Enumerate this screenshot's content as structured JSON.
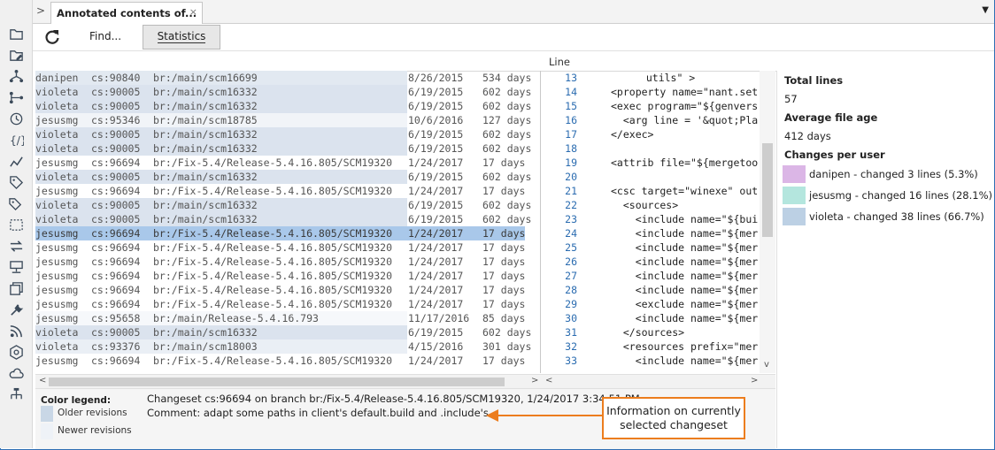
{
  "tab": {
    "prev": ">",
    "title": "Annotated contents of...",
    "close": "×",
    "menu": "▼"
  },
  "toolbar": {
    "find_label": "Find...",
    "statistics_label": "Statistics"
  },
  "grid": {
    "line_header": "Line",
    "rows": [
      {
        "user": "danipen",
        "cs": "cs:90840",
        "branch": "br:/main/scm16699",
        "date": "8/26/2015",
        "age": "534 days",
        "hl": "#e2e9f1"
      },
      {
        "user": "violeta",
        "cs": "cs:90005",
        "branch": "br:/main/scm16332",
        "date": "6/19/2015",
        "age": "602 days",
        "hl": "#dbe3ee"
      },
      {
        "user": "violeta",
        "cs": "cs:90005",
        "branch": "br:/main/scm16332",
        "date": "6/19/2015",
        "age": "602 days",
        "hl": "#dbe3ee"
      },
      {
        "user": "jesusmg",
        "cs": "cs:95346",
        "branch": "br:/main/scm18785",
        "date": "10/6/2016",
        "age": "127 days",
        "hl": "#f1f4f8"
      },
      {
        "user": "violeta",
        "cs": "cs:90005",
        "branch": "br:/main/scm16332",
        "date": "6/19/2015",
        "age": "602 days",
        "hl": "#dbe3ee"
      },
      {
        "user": "violeta",
        "cs": "cs:90005",
        "branch": "br:/main/scm16332",
        "date": "6/19/2015",
        "age": "602 days",
        "hl": "#dbe3ee"
      },
      {
        "user": "jesusmg",
        "cs": "cs:96694",
        "branch": "br:/Fix-5.4/Release-5.4.16.805/SCM19320",
        "date": "1/24/2017",
        "age": "17 days",
        "hl": "#ffffff"
      },
      {
        "user": "violeta",
        "cs": "cs:90005",
        "branch": "br:/main/scm16332",
        "date": "6/19/2015",
        "age": "602 days",
        "hl": "#dbe3ee"
      },
      {
        "user": "jesusmg",
        "cs": "cs:96694",
        "branch": "br:/Fix-5.4/Release-5.4.16.805/SCM19320",
        "date": "1/24/2017",
        "age": "17 days",
        "hl": "#ffffff"
      },
      {
        "user": "violeta",
        "cs": "cs:90005",
        "branch": "br:/main/scm16332",
        "date": "6/19/2015",
        "age": "602 days",
        "hl": "#dbe3ee"
      },
      {
        "user": "violeta",
        "cs": "cs:90005",
        "branch": "br:/main/scm16332",
        "date": "6/19/2015",
        "age": "602 days",
        "hl": "#dbe3ee"
      },
      {
        "user": "jesusmg",
        "cs": "cs:96694",
        "branch": "br:/Fix-5.4/Release-5.4.16.805/SCM19320",
        "date": "1/24/2017",
        "age": "17 days",
        "hl": "#a9c8ea"
      },
      {
        "user": "jesusmg",
        "cs": "cs:96694",
        "branch": "br:/Fix-5.4/Release-5.4.16.805/SCM19320",
        "date": "1/24/2017",
        "age": "17 days",
        "hl": "#ffffff"
      },
      {
        "user": "jesusmg",
        "cs": "cs:96694",
        "branch": "br:/Fix-5.4/Release-5.4.16.805/SCM19320",
        "date": "1/24/2017",
        "age": "17 days",
        "hl": "#ffffff"
      },
      {
        "user": "jesusmg",
        "cs": "cs:96694",
        "branch": "br:/Fix-5.4/Release-5.4.16.805/SCM19320",
        "date": "1/24/2017",
        "age": "17 days",
        "hl": "#ffffff"
      },
      {
        "user": "jesusmg",
        "cs": "cs:96694",
        "branch": "br:/Fix-5.4/Release-5.4.16.805/SCM19320",
        "date": "1/24/2017",
        "age": "17 days",
        "hl": "#ffffff"
      },
      {
        "user": "jesusmg",
        "cs": "cs:96694",
        "branch": "br:/Fix-5.4/Release-5.4.16.805/SCM19320",
        "date": "1/24/2017",
        "age": "17 days",
        "hl": "#ffffff"
      },
      {
        "user": "jesusmg",
        "cs": "cs:95658",
        "branch": "br:/main/Release-5.4.16.793",
        "date": "11/17/2016",
        "age": "85 days",
        "hl": "#f6f8fb"
      },
      {
        "user": "violeta",
        "cs": "cs:90005",
        "branch": "br:/main/scm16332",
        "date": "6/19/2015",
        "age": "602 days",
        "hl": "#dbe3ee"
      },
      {
        "user": "violeta",
        "cs": "cs:93376",
        "branch": "br:/main/scm18003",
        "date": "4/15/2016",
        "age": "301 days",
        "hl": "#eaeff5"
      },
      {
        "user": "jesusmg",
        "cs": "cs:96694",
        "branch": "br:/Fix-5.4/Release-5.4.16.805/SCM19320",
        "date": "1/24/2017",
        "age": "17 days",
        "hl": "#ffffff"
      }
    ]
  },
  "code": {
    "lines": [
      {
        "n": "13",
        "t": "  utils\" >"
      },
      {
        "n": "14",
        "t": "<property name=\"nant.set"
      },
      {
        "n": "15",
        "t": "<exec program=\"${genvers"
      },
      {
        "n": "16",
        "t": "  <arg line = '&quot;Pla"
      },
      {
        "n": "17",
        "t": "</exec>"
      },
      {
        "n": "18",
        "t": ""
      },
      {
        "n": "19",
        "t": "<attrib file=\"${mergetoo"
      },
      {
        "n": "20",
        "t": ""
      },
      {
        "n": "21",
        "t": "<csc target=\"winexe\" out"
      },
      {
        "n": "22",
        "t": "  <sources>"
      },
      {
        "n": "23",
        "t": "    <include name=\"${bui"
      },
      {
        "n": "24",
        "t": "    <include name=\"${mer"
      },
      {
        "n": "25",
        "t": "    <include name=\"${mer"
      },
      {
        "n": "26",
        "t": "    <include name=\"${mer"
      },
      {
        "n": "27",
        "t": "    <include name=\"${mer"
      },
      {
        "n": "28",
        "t": "    <include name=\"${mer"
      },
      {
        "n": "29",
        "t": "    <exclude name=\"${mer"
      },
      {
        "n": "30",
        "t": "    <include name=\"${mer"
      },
      {
        "n": "31",
        "t": "  </sources>"
      },
      {
        "n": "32",
        "t": "  <resources prefix=\"mer"
      },
      {
        "n": "33",
        "t": "    <include name=\"${mer"
      }
    ]
  },
  "stats": {
    "total_lines_label": "Total lines",
    "total_lines_value": "57",
    "avg_age_label": "Average file age",
    "avg_age_value": "412 days",
    "changes_label": "Changes per user",
    "users": [
      {
        "text": "danipen - changed 3 lines (5.3%)",
        "color": "#dbb6e6"
      },
      {
        "text": "jesusmg - changed 16 lines (28.1%)",
        "color": "#b4e6de"
      },
      {
        "text": "violeta - changed 38 lines (66.7%)",
        "color": "#bcd0e4"
      }
    ]
  },
  "legend": {
    "title": "Color legend:",
    "older": "Older revisions",
    "newer": "Newer revisions",
    "older_color": "#c9d7e6",
    "newer_color": "#eef2f7"
  },
  "info": {
    "changeset": "Changeset cs:96694 on branch br:/Fix-5.4/Release-5.4.16.805/SCM19320, 1/24/2017 3:34:51 PM",
    "comment": "Comment: adapt some paths in client's default.build and .include's"
  },
  "callout": {
    "line1": "Information on currently",
    "line2": "selected changeset",
    "color": "#ec7d1e"
  },
  "scroll": {
    "left": "<",
    "right": ">",
    "up": "^",
    "down": "v"
  },
  "icons": [
    "folder-icon",
    "folder-edit-icon",
    "branch-explorer-icon",
    "branches-icon",
    "history-icon",
    "code-review-icon",
    "chart-icon",
    "label-icon",
    "tags-icon",
    "shelves-icon",
    "sync-icon",
    "workspace-icon",
    "pending-changes-icon",
    "tools-icon",
    "feed-icon",
    "plastic-icon",
    "cloud-icon",
    "network-icon"
  ]
}
